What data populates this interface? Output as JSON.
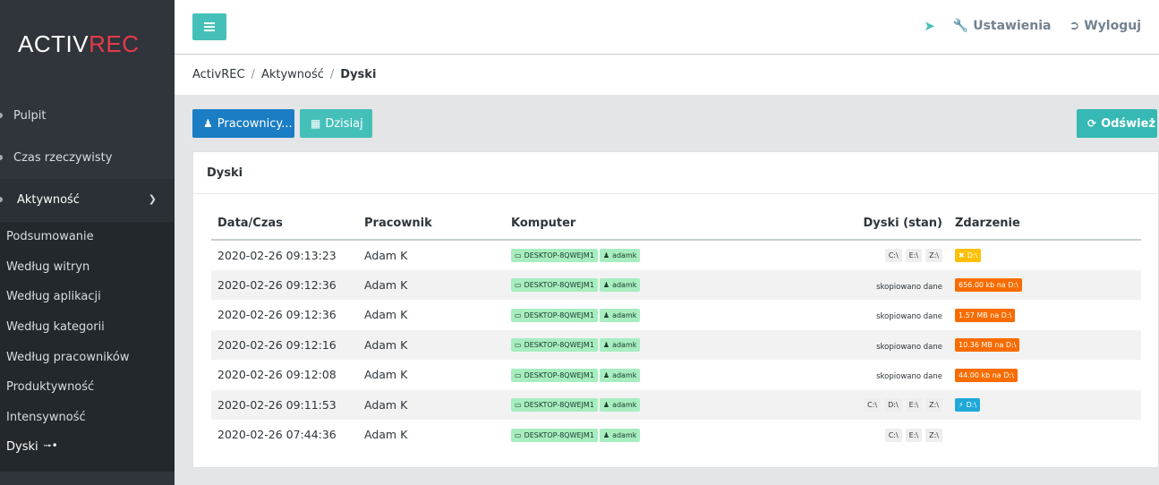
{
  "brand": {
    "part1": "ACTIV",
    "part2": "REC"
  },
  "sidebar": {
    "top_items": [
      {
        "label": "Pulpit"
      },
      {
        "label": "Czas rzeczywisty"
      },
      {
        "label": "Aktywność"
      }
    ],
    "sub_items": [
      {
        "label": "Podsumowanie"
      },
      {
        "label": "Według witryn"
      },
      {
        "label": "Według aplikacji"
      },
      {
        "label": "Według kategorii"
      },
      {
        "label": "Według pracowników"
      },
      {
        "label": "Produktywność"
      },
      {
        "label": "Intensywność"
      },
      {
        "label": "Dyski"
      }
    ]
  },
  "header": {
    "settings": "Ustawienia",
    "logout": "Wyloguj"
  },
  "breadcrumb": [
    "ActivREC",
    "Aktywność",
    "Dyski"
  ],
  "toolbar": {
    "workers": "Pracownicy...",
    "today": "Dzisiaj",
    "refresh": "Odśwież"
  },
  "card": {
    "title": "Dyski",
    "columns": [
      "Data/Czas",
      "Pracownik",
      "Komputer",
      "Dyski (stan)",
      "Zdarzenie"
    ],
    "rows": [
      {
        "datetime": "2020-02-26 09:13:23",
        "worker": "Adam K",
        "computer": "DESKTOP-8QWEJM1",
        "user": "adamk",
        "drives": [
          "C:\\",
          "E:\\",
          "Z:\\"
        ],
        "state": "",
        "event": "D:\\",
        "event_color": "yellow",
        "event_icon": "x-icon"
      },
      {
        "datetime": "2020-02-26 09:12:36",
        "worker": "Adam K",
        "computer": "DESKTOP-8QWEJM1",
        "user": "adamk",
        "drives": [],
        "state": "skopiowano dane",
        "event": "656.00 kb na D:\\",
        "event_color": "orange",
        "event_icon": ""
      },
      {
        "datetime": "2020-02-26 09:12:36",
        "worker": "Adam K",
        "computer": "DESKTOP-8QWEJM1",
        "user": "adamk",
        "drives": [],
        "state": "skopiowano dane",
        "event": "1.57 MB na D:\\",
        "event_color": "orange",
        "event_icon": ""
      },
      {
        "datetime": "2020-02-26 09:12:16",
        "worker": "Adam K",
        "computer": "DESKTOP-8QWEJM1",
        "user": "adamk",
        "drives": [],
        "state": "skopiowano dane",
        "event": "10.36 MB na D:\\",
        "event_color": "orange",
        "event_icon": ""
      },
      {
        "datetime": "2020-02-26 09:12:08",
        "worker": "Adam K",
        "computer": "DESKTOP-8QWEJM1",
        "user": "adamk",
        "drives": [],
        "state": "skopiowano dane",
        "event": "44.00 kb na D:\\",
        "event_color": "orange",
        "event_icon": ""
      },
      {
        "datetime": "2020-02-26 09:11:53",
        "worker": "Adam K",
        "computer": "DESKTOP-8QWEJM1",
        "user": "adamk",
        "drives": [
          "C:\\",
          "D:\\",
          "E:\\",
          "Z:\\"
        ],
        "state": "",
        "event": "D:\\",
        "event_color": "blue",
        "event_icon": "plug-icon"
      },
      {
        "datetime": "2020-02-26 07:44:36",
        "worker": "Adam K",
        "computer": "DESKTOP-8QWEJM1",
        "user": "adamk",
        "drives": [
          "C:\\",
          "E:\\",
          "Z:\\"
        ],
        "state": "",
        "event": "",
        "event_color": "",
        "event_icon": ""
      }
    ]
  },
  "colors": {
    "sidebar": "#2f353a",
    "accent_teal": "#45c0b9",
    "primary_blue": "#1b7dc4",
    "brand_red": "#e8394d",
    "event_yellow": "#ffc107",
    "event_orange": "#f86c00",
    "event_blue": "#20a8d8"
  }
}
